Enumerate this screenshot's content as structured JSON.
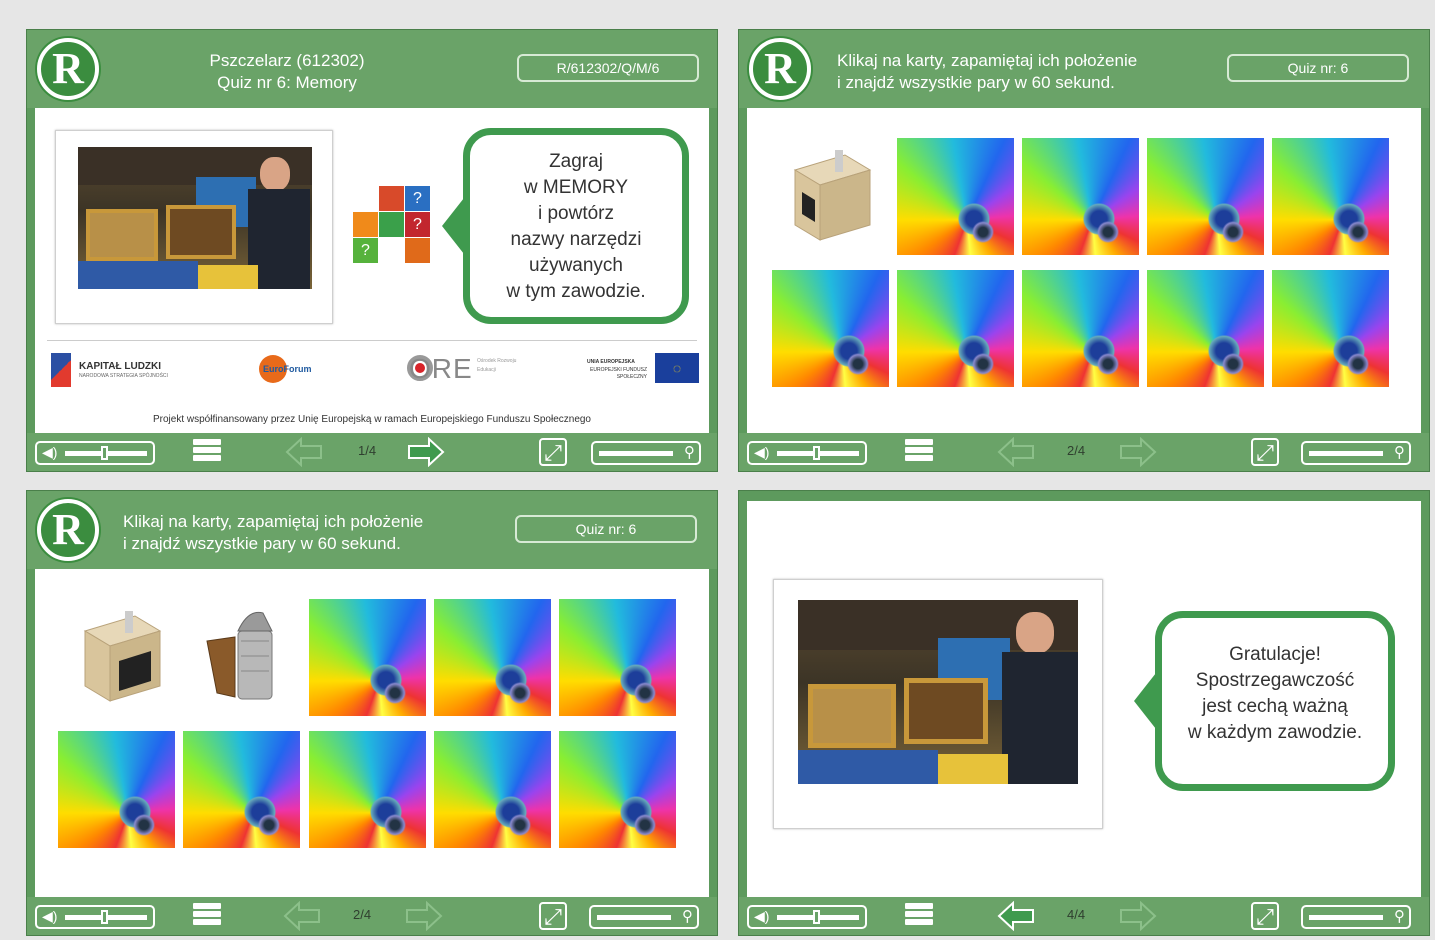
{
  "slide1": {
    "title_line1": "Pszczelarz (612302)",
    "title_line2": "Quiz nr 6: Memory",
    "code": "R/612302/Q/M/6",
    "bubble_lines": [
      "Zagraj",
      "w MEMORY",
      "i powtórz",
      "nazwy narzędzi",
      "używanych",
      "w tym zawodzie."
    ],
    "logo_kapital": "KAPITAŁ LUDZKI",
    "logo_kapital_sub": "NARODOWA STRATEGIA SPÓJNOŚCI",
    "logo_euroforum": "EuroForum",
    "logo_ore": "ORE",
    "logo_ore_sub": "Ośrodek Rozwoju Edukacji",
    "logo_ue": "UNIA EUROPEJSKA",
    "logo_ue_sub": "EUROPEJSKI FUNDUSZ SPOŁECZNY",
    "footer": "Projekt współfinansowany przez Unię Europejską w ramach Europejskiego Funduszu Społecznego",
    "page": "1/4"
  },
  "slide2": {
    "title_line1": "Klikaj na karty, zapamiętaj ich położenie",
    "title_line2": "i znajdź wszystkie pary w 60 sekund.",
    "code": "Quiz nr: 6",
    "page": "2/4"
  },
  "slide3": {
    "title_line1": "Klikaj na karty, zapamiętaj ich położenie",
    "title_line2": "i znajdź wszystkie pary w 60 sekund.",
    "code": "Quiz nr: 6",
    "page": "2/4"
  },
  "slide4": {
    "bubble_lines": [
      "Gratulacje!",
      "Spostrzegawczość",
      "jest cechą ważną",
      "w każdym zawodzie."
    ],
    "page": "4/4"
  },
  "colors": {
    "frame": "#5d9a5d",
    "header": "#6aa368",
    "bubble_border": "#3f9a4e"
  },
  "icons": [
    "speaker-icon",
    "menu-icon",
    "prev-arrow-icon",
    "next-arrow-icon",
    "fullscreen-icon",
    "zoom-icon",
    "r-logo-icon"
  ]
}
